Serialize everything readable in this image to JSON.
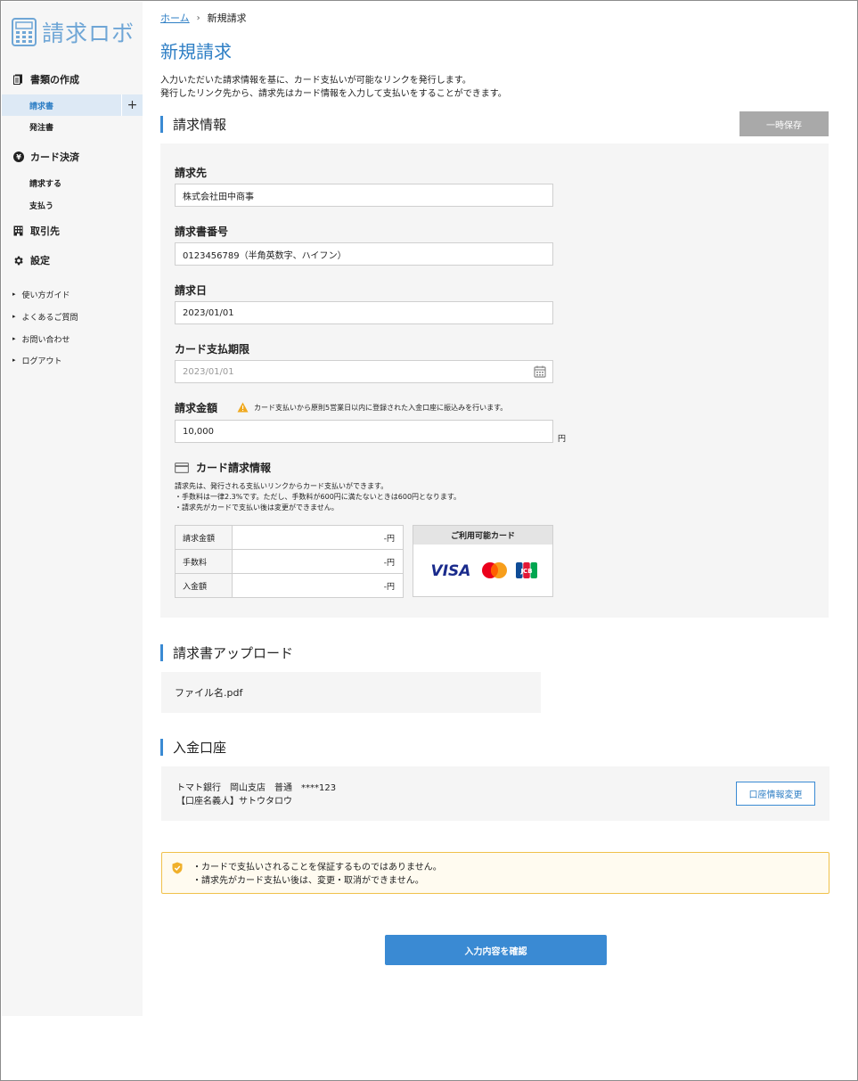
{
  "app": {
    "logo_text": "請求ロボ"
  },
  "sidebar": {
    "sections": [
      {
        "label": "書類の作成",
        "icon": "document-icon"
      },
      {
        "label": "カード決済",
        "icon": "yen-icon"
      },
      {
        "label": "取引先",
        "icon": "building-icon"
      },
      {
        "label": "設定",
        "icon": "gear-icon"
      }
    ],
    "create_items": [
      {
        "label": "請求書",
        "active": true
      },
      {
        "label": "発注書",
        "active": false
      }
    ],
    "card_items": [
      {
        "label": "請求する"
      },
      {
        "label": "支払う"
      }
    ],
    "plus_label": "+",
    "links": [
      {
        "label": "使い方ガイド"
      },
      {
        "label": "よくあるご質問"
      },
      {
        "label": "お問い合わせ"
      },
      {
        "label": "ログアウト"
      }
    ]
  },
  "breadcrumb": {
    "home": "ホーム",
    "separator": "›",
    "current": "新規請求"
  },
  "page": {
    "title": "新規請求",
    "description_1": "入力いただいた請求情報を基に、カード支払いが可能なリンクを発行します。",
    "description_2": "発行したリンク先から、請求先はカード情報を入力して支払いをすることができます。"
  },
  "invoice_section": {
    "title": "請求情報",
    "save_label": "一時保存",
    "fields": {
      "recipient_label": "請求先",
      "recipient_value": "株式会社田中商事",
      "number_label": "請求書番号",
      "number_value": "0123456789（半角英数字、ハイフン）",
      "date_label": "請求日",
      "date_value": "2023/01/01",
      "deadline_label": "カード支払期限",
      "deadline_placeholder": "2023/01/01",
      "amount_label": "請求金額",
      "amount_warning": "カード支払いから原則5営業日以内に登録された入金口座に振込みを行います。",
      "amount_value": "10,000",
      "amount_unit": "円"
    },
    "card_info": {
      "title": "カード請求情報",
      "line_1": "請求先は、発行される支払いリンクからカード支払いができます。",
      "line_2": "・手数料は一律2.3%です。ただし、手数料が600円に満たないときは600円となります。",
      "line_3": "・請求先がカードで支払い後は変更ができません。",
      "rows": [
        {
          "label": "請求金額",
          "value": "-円"
        },
        {
          "label": "手数料",
          "value": "-円"
        },
        {
          "label": "入金額",
          "value": "-円"
        }
      ],
      "available_cards_title": "ご利用可能カード",
      "visa_text": "VISA",
      "jcb_text": "JCB"
    }
  },
  "upload_section": {
    "title": "請求書アップロード",
    "file_name": "ファイル名.pdf"
  },
  "bank_section": {
    "title": "入金口座",
    "account_line": "トマト銀行　岡山支店　普通　****123",
    "holder_line": "【口座名義人】サトウタロウ",
    "change_label": "口座情報変更"
  },
  "notice": {
    "line_1": "・カードで支払いされることを保証するものではありません。",
    "line_2": "・請求先がカード支払い後は、変更・取消ができません。"
  },
  "confirm_label": "入力内容を確認",
  "colors": {
    "accent": "#3a8ad3",
    "logo": "#6fa6d6",
    "notice_border": "#f0c14b"
  }
}
